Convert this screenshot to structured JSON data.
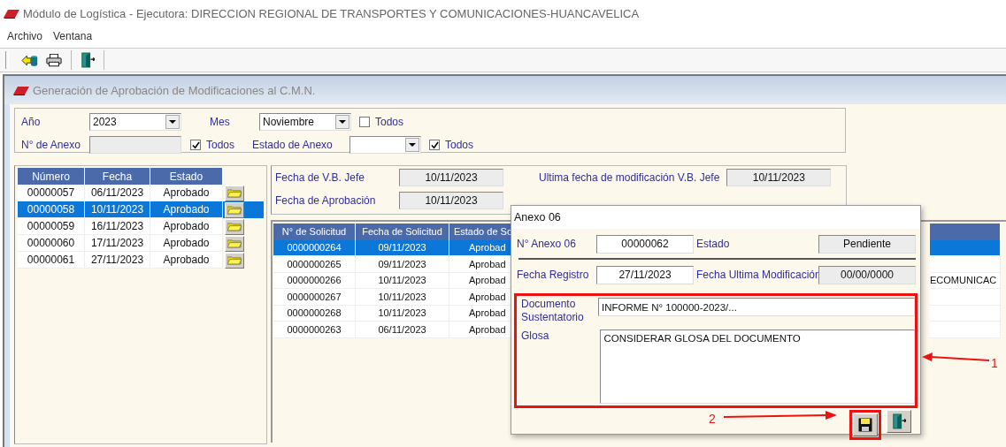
{
  "window": {
    "title": "Módulo de Logística - Ejecutora: DIRECCION REGIONAL DE TRANSPORTES Y COMUNICACIONES-HUANCAVELICA"
  },
  "menu": [
    "Archivo",
    "Ventana"
  ],
  "child_window": {
    "title": "Generación de Aprobación de Modificaciones al C.M.N."
  },
  "filters": {
    "anio": {
      "label": "Año",
      "value": "2023"
    },
    "mes": {
      "label": "Mes",
      "value": "Noviembre",
      "todos_label": "Todos",
      "todos_checked": false
    },
    "anexo": {
      "label": "N° de Anexo",
      "todos_label": "Todos",
      "todos_checked": true
    },
    "estado": {
      "label": "Estado de Anexo",
      "todos_label": "Todos",
      "todos_checked": true
    }
  },
  "anexos_table": {
    "columns": [
      "Número",
      "Fecha",
      "Estado"
    ],
    "rows": [
      {
        "cells": [
          "00000057",
          "06/11/2023",
          "Aprobado"
        ],
        "selected": false
      },
      {
        "cells": [
          "00000058",
          "10/11/2023",
          "Aprobado"
        ],
        "selected": true
      },
      {
        "cells": [
          "00000059",
          "16/11/2023",
          "Aprobado"
        ],
        "selected": false
      },
      {
        "cells": [
          "00000060",
          "17/11/2023",
          "Aprobado"
        ],
        "selected": false
      },
      {
        "cells": [
          "00000061",
          "27/11/2023",
          "Aprobado"
        ],
        "selected": false
      }
    ]
  },
  "fechas": {
    "vb_jefe": {
      "label": "Fecha de V.B. Jefe",
      "value": "10/11/2023"
    },
    "ultima_vb_jefe": {
      "label": "Ultima fecha de modificación V.B. Jefe",
      "value": "10/11/2023"
    },
    "aprobacion": {
      "label": "Fecha de Aprobación",
      "value": "10/11/2023"
    }
  },
  "solicitudes_table": {
    "columns": [
      "N° de Solicitud",
      "Fecha de Solicitud",
      "Estado de So"
    ],
    "rows": [
      {
        "cells": [
          "0000000264",
          "09/11/2023",
          "Aprobad"
        ],
        "selected": true
      },
      {
        "cells": [
          "0000000265",
          "09/11/2023",
          "Aprobad"
        ],
        "selected": false
      },
      {
        "cells": [
          "0000000266",
          "10/11/2023",
          "Aprobad"
        ],
        "column_4": "ECOMUNICAC",
        "selected": false
      },
      {
        "cells": [
          "0000000267",
          "10/11/2023",
          "Aprobad"
        ],
        "selected": false
      },
      {
        "cells": [
          "0000000268",
          "10/11/2023",
          "Aprobad"
        ],
        "selected": false
      },
      {
        "cells": [
          "0000000263",
          "06/11/2023",
          "Aprobad"
        ],
        "selected": false
      }
    ]
  },
  "dialog": {
    "title": "Anexo 06",
    "numero": {
      "label": "N° Anexo 06",
      "value": "00000062"
    },
    "estado": {
      "label": "Estado",
      "value": "Pendiente"
    },
    "fecha_registro": {
      "label": "Fecha Registro",
      "value": "27/11/2023"
    },
    "fecha_modificacion": {
      "label": "Fecha Ultima Modificación",
      "value": "00/00/0000"
    },
    "documento": {
      "label": "Documento Sustentatorio",
      "value": "INFORME N° 100000-2023/..."
    },
    "glosa": {
      "label": "Glosa",
      "value": "CONSIDERAR GLOSA DEL DOCUMENTO"
    }
  },
  "annotations": [
    "1",
    "2"
  ]
}
